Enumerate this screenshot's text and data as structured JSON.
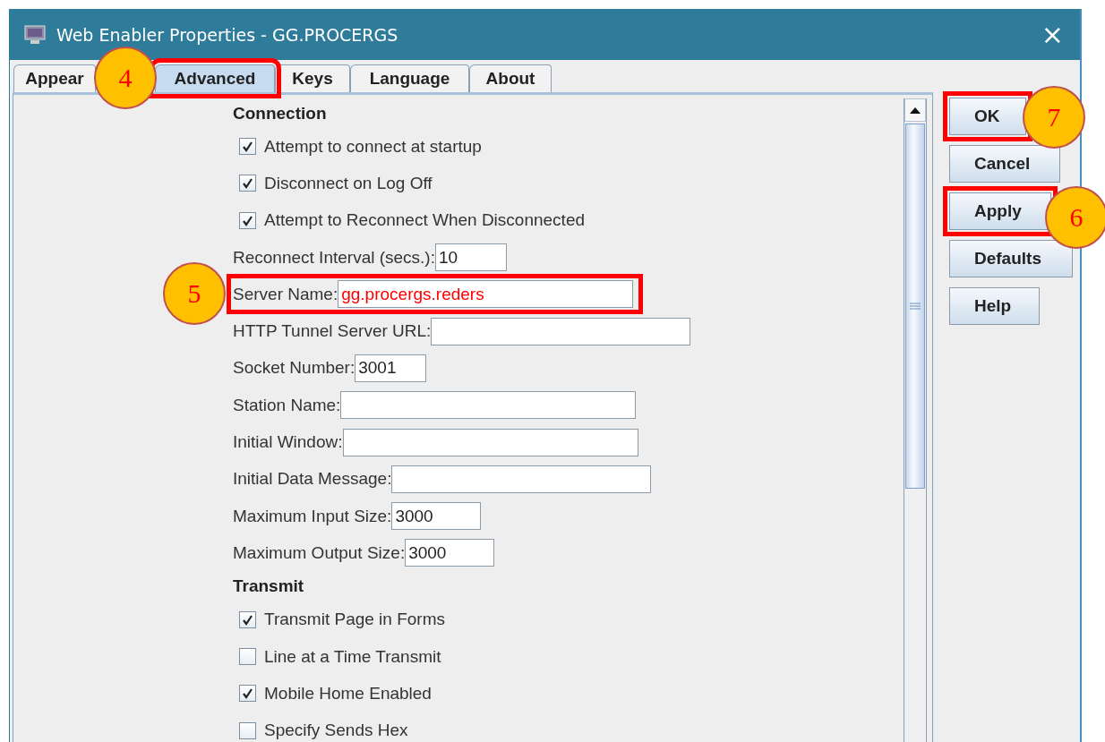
{
  "window": {
    "title": "Web Enabler Properties - GG.PROCERGS",
    "close": "×"
  },
  "tabs": [
    {
      "label": "Appear",
      "selected": false
    },
    {
      "label": "Advanced",
      "selected": true,
      "highlighted": true
    },
    {
      "label": "Keys",
      "selected": false
    },
    {
      "label": "Language",
      "selected": false
    },
    {
      "label": "About",
      "selected": false
    }
  ],
  "form": [
    {
      "kind": "heading",
      "label": "Connection"
    },
    {
      "kind": "checkbox",
      "label": "Attempt to connect at startup",
      "checked": true
    },
    {
      "kind": "checkbox",
      "label": "Disconnect on Log Off",
      "checked": true
    },
    {
      "kind": "checkbox",
      "label": "Attempt to Reconnect When Disconnected",
      "checked": true
    },
    {
      "kind": "field",
      "label": "Reconnect Interval (secs.):",
      "value": "10"
    },
    {
      "kind": "field",
      "label": "Server Name:",
      "value": "gg.procergs.reders",
      "highlighted": true
    },
    {
      "kind": "field",
      "label": "HTTP Tunnel Server URL:"
    },
    {
      "kind": "field",
      "label": "Socket Number:",
      "value": "3001"
    },
    {
      "kind": "field",
      "label": "Station Name:"
    },
    {
      "kind": "field",
      "label": "Initial Window:"
    },
    {
      "kind": "field",
      "label": "Initial Data Message:"
    },
    {
      "kind": "field",
      "label": "Maximum Input Size:",
      "value": "3000"
    },
    {
      "kind": "field",
      "label": "Maximum Output Size:",
      "value": "3000"
    },
    {
      "kind": "heading",
      "label": "Transmit"
    },
    {
      "kind": "checkbox",
      "label": "Transmit Page in Forms",
      "checked": true
    },
    {
      "kind": "checkbox",
      "label": "Line at a Time Transmit",
      "checked": false
    },
    {
      "kind": "checkbox",
      "label": "Mobile Home Enabled",
      "checked": true
    },
    {
      "kind": "checkbox",
      "label": "Specify Sends Hex",
      "checked": false
    }
  ],
  "buttons": [
    {
      "label": "OK",
      "highlighted": true
    },
    {
      "label": "Cancel"
    },
    {
      "label": "Apply",
      "highlighted": true
    },
    {
      "label": "Defaults"
    },
    {
      "label": "Help"
    }
  ],
  "callouts": [
    {
      "number": "4"
    },
    {
      "number": "5"
    },
    {
      "number": "7"
    },
    {
      "number": "6"
    }
  ]
}
